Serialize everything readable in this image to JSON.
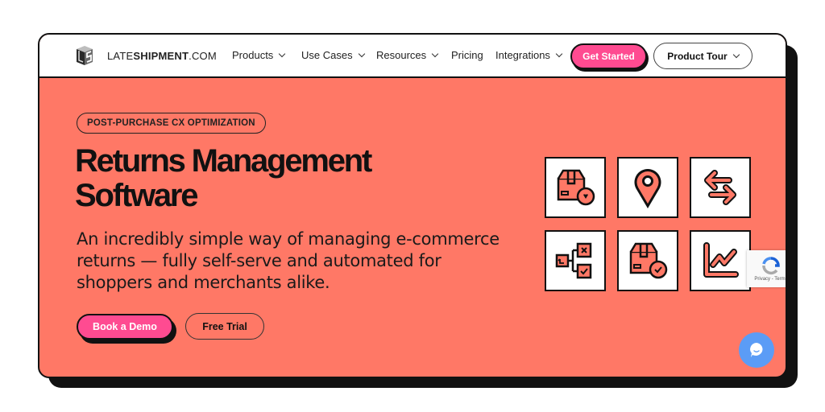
{
  "brand": {
    "name_light_prefix": "LATE",
    "name_bold": "SHIPMENT",
    "name_light_suffix": ".COM",
    "logo_icon": "ls-cube-logo-icon"
  },
  "nav": {
    "items": [
      {
        "label": "Products",
        "has_dropdown": true
      },
      {
        "label": "Use Cases",
        "has_dropdown": true
      },
      {
        "label": "Resources",
        "has_dropdown": true
      },
      {
        "label": "Pricing",
        "has_dropdown": false
      },
      {
        "label": "Integrations",
        "has_dropdown": true
      }
    ],
    "cta_primary": "Get Started",
    "cta_secondary": "Product Tour"
  },
  "hero": {
    "eyebrow": "POST-PURCHASE CX OPTIMIZATION",
    "title_line1": "Returns Management",
    "title_line2": "Software",
    "subtitle": "An incredibly simple way of managing e-commerce returns — fully self-serve and automated for shoppers and merchants alike.",
    "primary_button": "Book a Demo",
    "secondary_button": "Free Trial"
  },
  "feature_tiles": [
    {
      "icon": "box-heart-return-icon"
    },
    {
      "icon": "location-pin-icon"
    },
    {
      "icon": "exchange-arrows-icon"
    },
    {
      "icon": "workflow-approve-reject-icon"
    },
    {
      "icon": "box-check-return-icon"
    },
    {
      "icon": "trend-chart-icon"
    }
  ],
  "recaptcha": {
    "text": "Privacy - Terms"
  },
  "colors": {
    "hero_bg": "#ff7866",
    "accent_pink": "#ff4b91",
    "chat_blue": "#5b9cf6",
    "ink": "#111111"
  }
}
